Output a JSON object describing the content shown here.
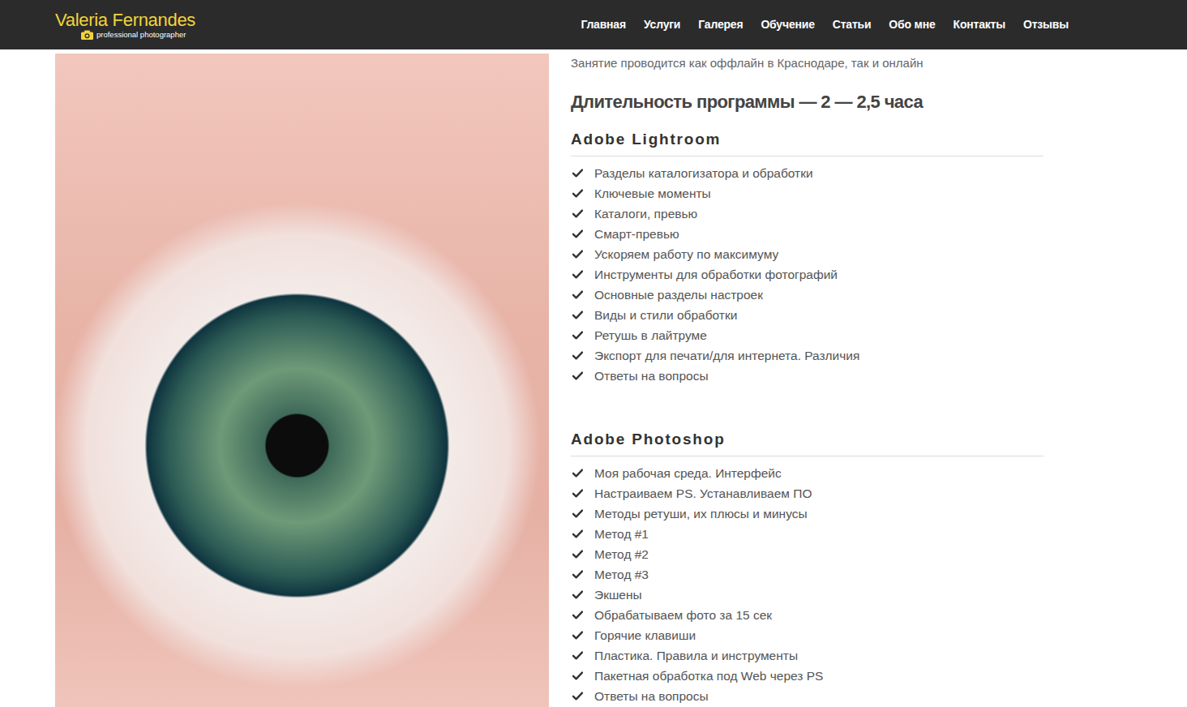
{
  "header": {
    "logo": {
      "title": "Valeria Fernandes",
      "subtitle": "professional photographer"
    },
    "nav": [
      "Главная",
      "Услуги",
      "Галерея",
      "Обучение",
      "Статьи",
      "Обо мне",
      "Контакты",
      "Отзывы"
    ]
  },
  "intro": "Занятие проводится как оффлайн в Краснодаре, так и онлайн",
  "duration": "Длительность программы — 2 — 2,5 часа",
  "sections": [
    {
      "title": "Adobe Lightroom",
      "items": [
        "Разделы каталогизатора и обработки",
        "Ключевые моменты",
        "Каталоги, превью",
        "Смарт-превью",
        "Ускоряем работу по максимуму",
        "Инструменты для обработки фотографий",
        "Основные разделы настроек",
        "Виды и стили обработки",
        "Ретушь в лайтруме",
        "Экспорт для печати/для интернета. Различия",
        "Ответы на вопросы"
      ]
    },
    {
      "title": "Adobe Photoshop",
      "items": [
        "Моя рабочая среда. Интерфейс",
        "Настраиваем PS. Устанавливаем ПО",
        "Методы ретуши, их плюсы и минусы",
        "Метод #1",
        "Метод #2",
        "Метод #3",
        "Экшены",
        "Обрабатываем фото за 15 сек",
        "Горячие клавиши",
        "Пластика. Правила и инструменты",
        "Пакетная обработка под Web через PS",
        "Ответы на вопросы"
      ]
    }
  ]
}
